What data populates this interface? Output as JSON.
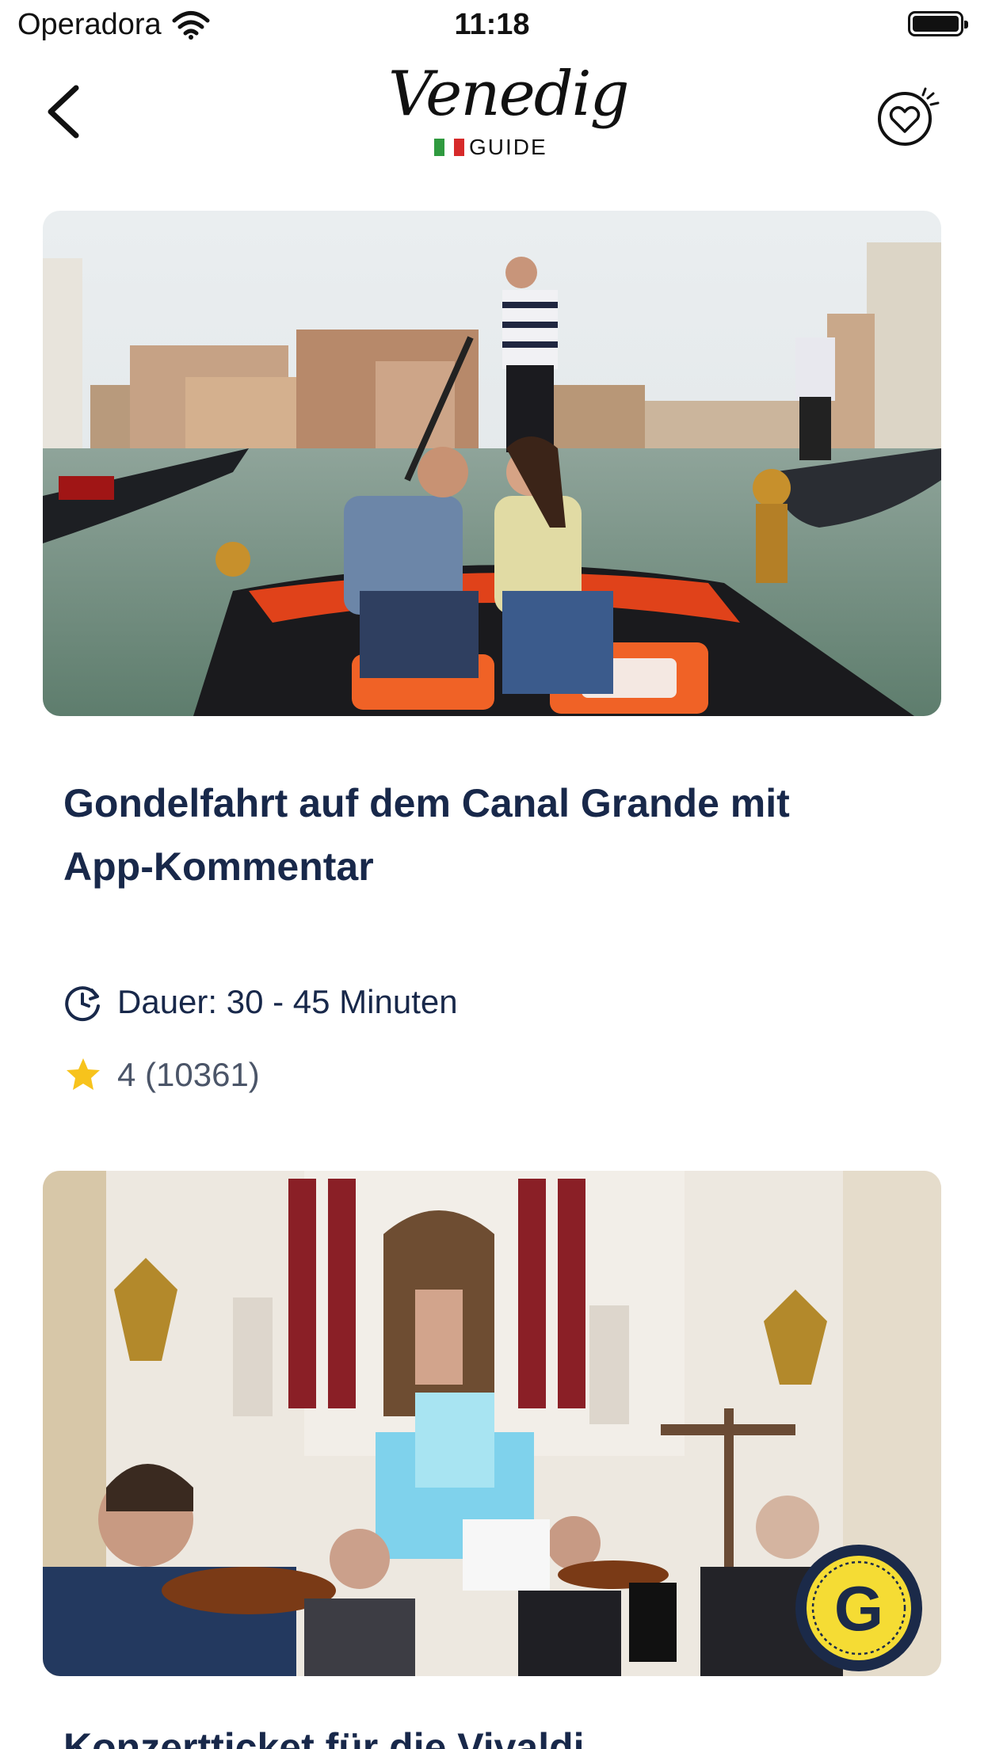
{
  "status_bar": {
    "carrier": "Operadora",
    "time": "11:18"
  },
  "header": {
    "logo_script": "Venedig",
    "logo_sub": "GUIDE",
    "flag_colors": [
      "#2f9a3f",
      "#ffffff",
      "#d62a2a"
    ]
  },
  "cards": [
    {
      "title_line1": "Gondelfahrt auf dem Canal Grande mit",
      "title_line2": "App-Kommentar",
      "duration": "Dauer: 30 - 45 Minuten",
      "rating": "4 (10361)"
    },
    {
      "title_partial": "Konzertticket für die Vivaldi"
    }
  ],
  "fab": {
    "label": "G"
  },
  "colors": {
    "title": "#18284a",
    "star": "#f7c31c",
    "fab_bg": "#1b2a49",
    "fab_ring": "#f5dc34"
  }
}
